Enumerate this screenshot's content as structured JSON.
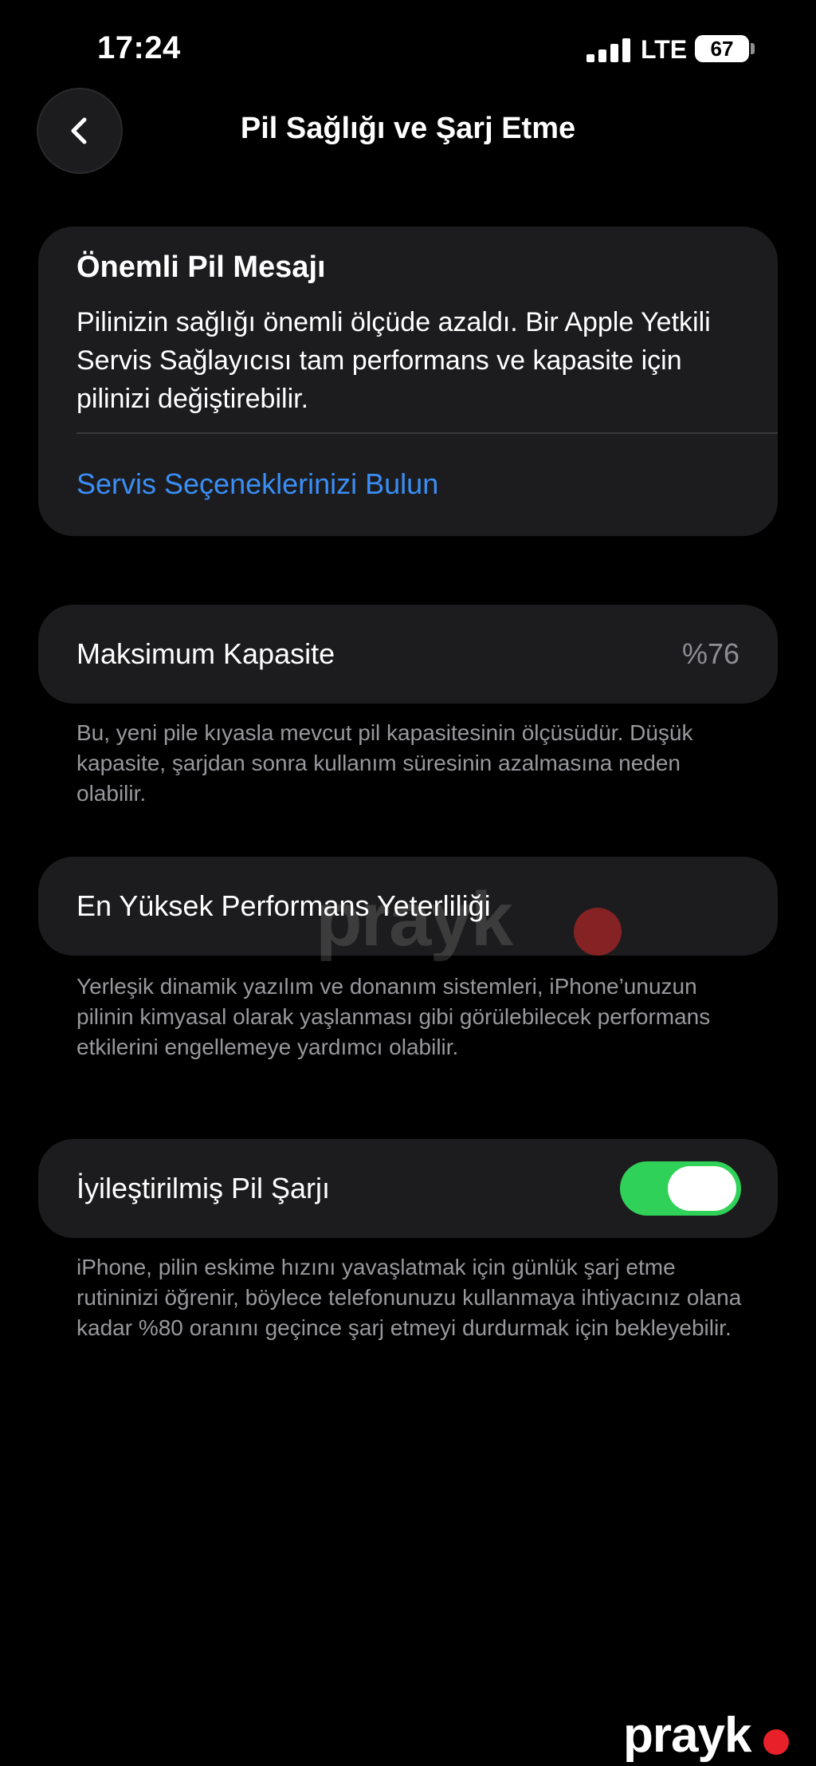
{
  "status_bar": {
    "time": "17:24",
    "network": "LTE",
    "battery_level": "67"
  },
  "nav": {
    "title": "Pil Sağlığı ve Şarj Etme",
    "back_icon": "chevron-left-icon"
  },
  "message_card": {
    "title": "Önemli Pil Mesajı",
    "body": "Pilinizin sağlığı önemli ölçüde azaldı. Bir Apple Yetkili Servis Sağlayıcısı tam performans ve kapasite için pilinizi değiştirebilir.",
    "link": "Servis Seçeneklerinizi Bulun"
  },
  "capacity": {
    "label": "Maksimum Kapasite",
    "value": "%76",
    "footnote": "Bu, yeni pile kıyasla mevcut pil kapasitesinin ölçüsüdür. Düşük kapasite, şarjdan sonra kullanım süresinin azalmasına neden olabilir."
  },
  "performance": {
    "label": "En Yüksek Performans Yeterliliği",
    "footnote": "Yerleşik dinamik yazılım ve donanım sistemleri, iPhone’unuzun pilinin kimyasal olarak yaşlanması gibi görülebilecek performans etkilerini engellemeye yardımcı olabilir."
  },
  "charging": {
    "label": "İyileştirilmiş Pil Şarjı",
    "enabled": true,
    "footnote": "iPhone, pilin eskime hızını yavaşlatmak için günlük şarj etme rutininizi öğrenir, böylece telefonunuzu kullanmaya ihtiyacınız olana kadar %80 oranını geçince şarj etmeyi durdurmak için bekleyebilir."
  },
  "colors": {
    "accent_link": "#3a8ef5",
    "toggle_on": "#30d158",
    "card_bg": "#1c1c1e"
  },
  "watermark": {
    "text": "prayk"
  },
  "logo": {
    "text": "prayk"
  }
}
